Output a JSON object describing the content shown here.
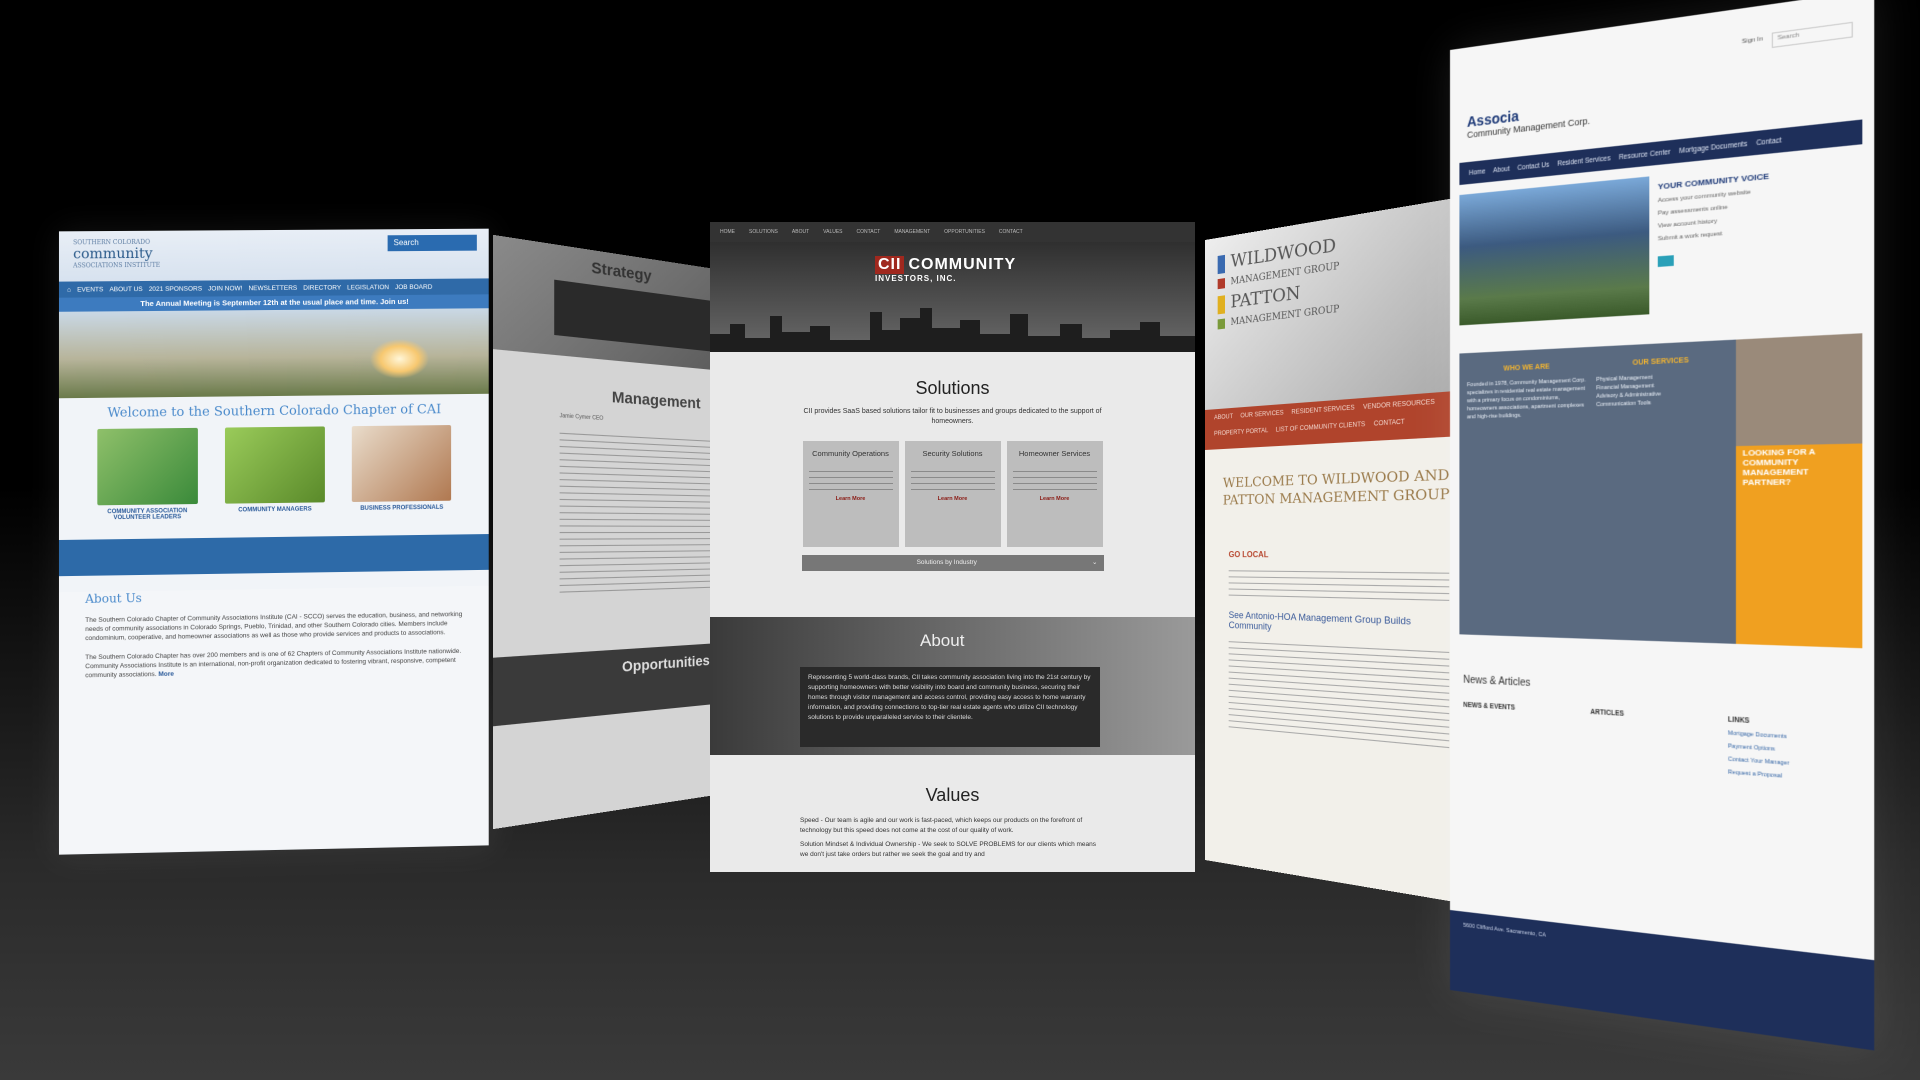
{
  "cai": {
    "logo_small": "SOUTHERN COLORADO",
    "logo_main": "community",
    "logo_tag": "ASSOCIATIONS INSTITUTE",
    "search": "Search",
    "nav": [
      "EVENTS",
      "ABOUT US",
      "2021 SPONSORS",
      "JOIN NOW!",
      "NEWSLETTERS",
      "DIRECTORY",
      "LEGISLATION",
      "JOB BOARD"
    ],
    "banner": "The Annual Meeting is September 12th at the usual place and time. Join us!",
    "welcome": "Welcome to the Southern Colorado Chapter of CAI",
    "cards": [
      "COMMUNITY ASSOCIATION VOLUNTEER LEADERS",
      "COMMUNITY MANAGERS",
      "BUSINESS PROFESSIONALS"
    ],
    "about_title": "About Us",
    "about_p1": "The Southern Colorado Chapter of Community Associations Institute (CAI - SCCO) serves the education, business, and networking needs of community associations in Colorado Springs, Pueblo, Trinidad, and other Southern Colorado cities. Members include condominium, cooperative, and homeowner associations as well as those who provide services and products to associations.",
    "about_p2": "The Southern Colorado Chapter has over 200 members and is one of 62 Chapters of Community Associations Institute nationwide. Community Associations Institute is an international, non-profit organization dedicated to fostering vibrant, responsive, competent community associations.",
    "more": "More"
  },
  "strategy": {
    "title": "Strategy",
    "management": "Management",
    "opportunities": "Opportunities",
    "text": "Jamie Cymer CEO"
  },
  "ci": {
    "nav": [
      "HOME",
      "SOLUTIONS",
      "ABOUT",
      "VALUES",
      "CONTACT",
      "MANAGEMENT",
      "OPPORTUNITIES",
      "CONTACT"
    ],
    "logo_line1": "COMMUNITY",
    "logo_line2": "INVESTORS, INC.",
    "logo_mark": "CII",
    "solutions_title": "Solutions",
    "solutions_sub": "CII provides SaaS based solutions tailor fit to businesses and groups dedicated to the support of homeowners.",
    "boxes": [
      {
        "title": "Community Operations",
        "link": "Learn More"
      },
      {
        "title": "Security Solutions",
        "link": "Learn More"
      },
      {
        "title": "Homeowner Services",
        "link": "Learn More"
      }
    ],
    "industry_bar": "Solutions by Industry",
    "about_title": "About",
    "about_text": "Representing 5 world-class brands, CII takes community association living into the 21st century by supporting homeowners with better visibility into board and community business, securing their homes through visitor management and access control, providing easy access to home warranty information, and providing connections to top-tier real estate agents who utilize CII technology solutions to provide unparalleled service to their clientele.",
    "values_title": "Values",
    "values_text1": "Speed - Our team is agile and our work is fast-paced, which keeps our products on the forefront of technology but this speed does not come at the cost of our quality of work.",
    "values_text2": "Solution Mindset & Individual Ownership - We seek to SOLVE PROBLEMS for our clients which means we don't just take orders but rather we seek the goal and try and"
  },
  "wildwood": {
    "logo_l1": "WILDWOOD",
    "logo_l2": "MANAGEMENT GROUP",
    "logo_l3": "PATTON",
    "logo_l4": "MANAGEMENT GROUP",
    "nav": [
      "ABOUT",
      "OUR SERVICES",
      "RESIDENT SERVICES",
      "VENDOR RESOURCES",
      "PROPERTY PORTAL",
      "LIST OF COMMUNITY CLIENTS",
      "CONTACT"
    ],
    "title": "WELCOME TO WILDWOOD AND PATTON MANAGEMENT GROUP",
    "go_local": "GO LOCAL",
    "link": "See Antonio-HOA Management Group Builds Community"
  },
  "associa": {
    "search": "Search",
    "sign_in": "Sign In",
    "logo": "Associa",
    "logo_sub": "Community Management Corp.",
    "nav": [
      "Home",
      "About",
      "Contact Us",
      "Resident Services",
      "Resource Center",
      "Mortgage Documents",
      "Contact"
    ],
    "voice_title": "YOUR COMMUNITY VOICE",
    "voice_items": [
      "Access your community website",
      "Pay assessments online",
      "View account history",
      "Submit a work request"
    ],
    "who_title": "WHO WE ARE",
    "who_text": "Founded in 1978, Community Management Corp. specializes in residential real estate management with a primary focus on condominiums, homeowners associations, apartment complexes and high-rise buildings.",
    "services_title": "OUR SERVICES",
    "services_list": [
      "Physical Management",
      "Financial Management",
      "Advisory & Administrative",
      "Communication Tools"
    ],
    "orange_text": "LOOKING FOR A COMMUNITY MANAGEMENT PARTNER?",
    "news_title": "News & Articles",
    "col1_title": "NEWS & EVENTS",
    "col2_title": "ARTICLES",
    "col3_title": "LINKS",
    "col3_items": [
      "Mortgage Documents",
      "Payment Options",
      "Contact Your Manager",
      "Request a Proposal"
    ],
    "footer": "5600 Clifford Ave. Sacramento, CA"
  },
  "colors": {
    "cai_blue": "#2f6aa8",
    "ci_red": "#a0281e",
    "wildwood_orange": "#b0442c",
    "associa_navy": "#1e2f5a",
    "associa_orange": "#f0a020"
  }
}
